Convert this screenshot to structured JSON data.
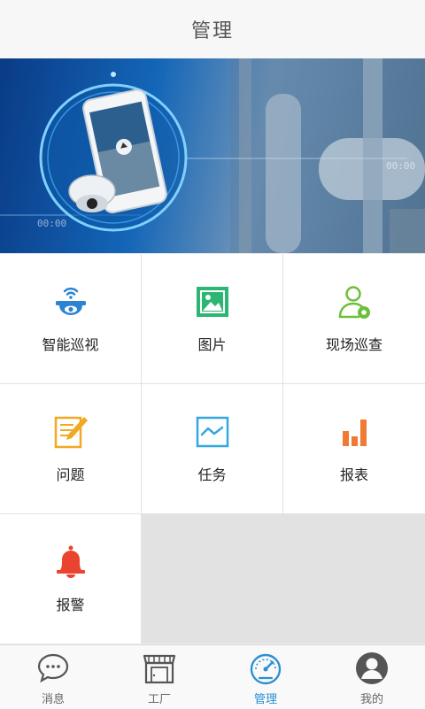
{
  "header": {
    "title": "管理"
  },
  "banner": {
    "time_left": "00:00",
    "time_right": "00:00"
  },
  "menu": {
    "items": [
      {
        "label": "智能巡视",
        "icon": "camera-wifi-icon",
        "color": "#2a84d2"
      },
      {
        "label": "图片",
        "icon": "picture-icon",
        "color": "#2bb673"
      },
      {
        "label": "现场巡查",
        "icon": "inspector-icon",
        "color": "#6cbf3b"
      },
      {
        "label": "问题",
        "icon": "note-pencil-icon",
        "color": "#f2a821"
      },
      {
        "label": "任务",
        "icon": "task-chart-icon",
        "color": "#33a8de"
      },
      {
        "label": "报表",
        "icon": "bar-chart-icon",
        "color": "#f07a34"
      },
      {
        "label": "报警",
        "icon": "alarm-bell-icon",
        "color": "#e8442f"
      }
    ]
  },
  "tabs": {
    "active": "管理",
    "items": [
      {
        "label": "消息",
        "icon": "chat-bubble-icon"
      },
      {
        "label": "工厂",
        "icon": "factory-store-icon"
      },
      {
        "label": "管理",
        "icon": "speedometer-icon"
      },
      {
        "label": "我的",
        "icon": "user-avatar-icon"
      }
    ]
  },
  "colors": {
    "accent": "#2a8fd4",
    "tab_inactive": "#666666"
  }
}
